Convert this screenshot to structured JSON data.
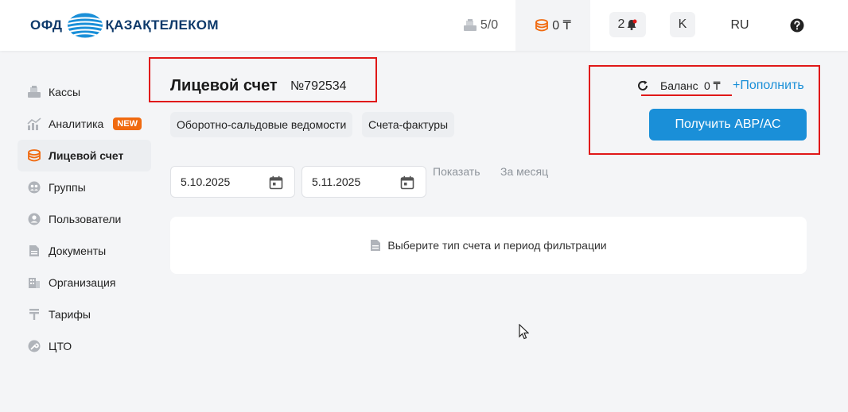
{
  "header": {
    "logo_ofd": "ОФД",
    "logo_company": "ҚАЗАҚТЕЛЕКОМ",
    "kassa_count": "5/0",
    "balance": "0 ₸",
    "notifications": "2",
    "avatar_letter": "K",
    "language": "RU",
    "help_icon": "question-circle-icon"
  },
  "sidebar": {
    "items": [
      {
        "label": "Кассы",
        "icon": "cash-register-icon"
      },
      {
        "label": "Аналитика",
        "icon": "analytics-icon",
        "badge": "NEW"
      },
      {
        "label": "Лицевой счет",
        "icon": "coins-icon",
        "active": true
      },
      {
        "label": "Группы",
        "icon": "groups-icon"
      },
      {
        "label": "Пользователи",
        "icon": "user-icon"
      },
      {
        "label": "Документы",
        "icon": "document-icon"
      },
      {
        "label": "Организация",
        "icon": "building-icon"
      },
      {
        "label": "Тарифы",
        "icon": "tariff-icon"
      },
      {
        "label": "ЦТО",
        "icon": "wrench-icon"
      }
    ]
  },
  "main": {
    "title": "Лицевой счет",
    "account_number": "№792534",
    "tabs": [
      {
        "label": "Оборотно-сальдовые ведомости"
      },
      {
        "label": "Счета-фактуры"
      }
    ],
    "balance_label": "Баланс",
    "balance_value": "0 ₸",
    "topup_label": "+Пополнить",
    "avr_button": "Получить АВР/АС",
    "date_from": "5.10.2025",
    "date_to": "5.11.2025",
    "show_label": "Показать",
    "month_label": "За месяц",
    "empty_message": "Выберите тип счета и период фильтрации"
  },
  "colors": {
    "accent": "#1a8fd8",
    "annotation_red": "#e01818",
    "badge_orange": "#f06a10",
    "coin_orange": "#f06a10"
  }
}
